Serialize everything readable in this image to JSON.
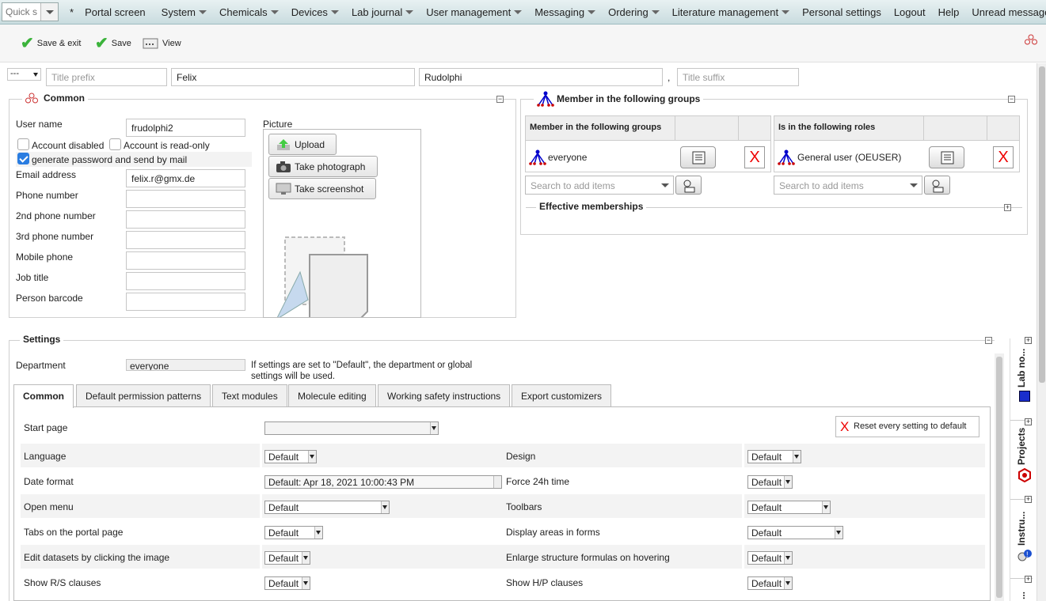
{
  "menubar": {
    "quick_search_placeholder": "Quick s",
    "star": "*",
    "items": [
      "Portal screen",
      "System",
      "Chemicals",
      "Devices",
      "Lab journal",
      "User management",
      "Messaging",
      "Ordering",
      "Literature management",
      "Personal settings",
      "Logout",
      "Help",
      "Unread messages"
    ]
  },
  "toolbar": {
    "save_exit": "Save & exit",
    "save": "Save",
    "view": "View"
  },
  "name": {
    "salutation": "---",
    "title_prefix_placeholder": "Title prefix",
    "first_name": "Felix",
    "last_name": "Rudolphi",
    "comma": ",",
    "title_suffix_placeholder": "Title suffix"
  },
  "common": {
    "legend": "Common",
    "username_label": "User name",
    "username": "frudolphi2",
    "account_disabled": "Account disabled",
    "account_readonly": "Account is read-only",
    "gen_password": "generate password and send by mail",
    "email_label": "Email address",
    "email": "felix.r@gmx.de",
    "phone": "Phone number",
    "phone2": "2nd phone number",
    "phone3": "3rd phone number",
    "mobile": "Mobile phone",
    "job": "Job title",
    "barcode": "Person barcode",
    "picture_label": "Picture",
    "upload": "Upload",
    "take_photo": "Take photograph",
    "take_screenshot": "Take screenshot"
  },
  "groups": {
    "legend": "Member in the following groups",
    "groups_header": "Member in the following groups",
    "group_item": "everyone",
    "roles_header": "Is in the following roles",
    "role_item": "General user (OEUSER)",
    "search_placeholder": "Search to add items",
    "x": "X",
    "effective": "Effective memberships"
  },
  "settings": {
    "legend": "Settings",
    "department_label": "Department",
    "department": "everyone",
    "note": "If settings are set to \"Default\", the department or global settings will be used.",
    "tabs": [
      "Common",
      "Default permission patterns",
      "Text modules",
      "Molecule editing",
      "Working safety instructions",
      "Export customizers"
    ],
    "reset": "Reset every setting to default",
    "start_page": "Start page",
    "rows": [
      {
        "l1": "Language",
        "v1": "Default",
        "l2": "Design",
        "v2": "Default"
      },
      {
        "l1": "Date format",
        "v1": "Default: Apr 18, 2021 10:00:43 PM",
        "l2": "Force 24h time",
        "v2": "Default"
      },
      {
        "l1": "Open menu",
        "v1": "Default",
        "l2": "Toolbars",
        "v2": "Default"
      },
      {
        "l1": "Tabs on the portal page",
        "v1": "Default",
        "l2": "Display areas in forms",
        "v2": "Default"
      },
      {
        "l1": "Edit datasets by clicking the image",
        "v1": "Default",
        "l2": "Enlarge structure formulas on hovering",
        "v2": "Default"
      },
      {
        "l1": "Show R/S clauses",
        "v1": "Default",
        "l2": "Show H/P clauses",
        "v2": "Default"
      }
    ]
  },
  "sidebar": {
    "lab_notebook": "Lab no...",
    "projects": "Projects",
    "instruments": "Instru...",
    "more": "..."
  }
}
